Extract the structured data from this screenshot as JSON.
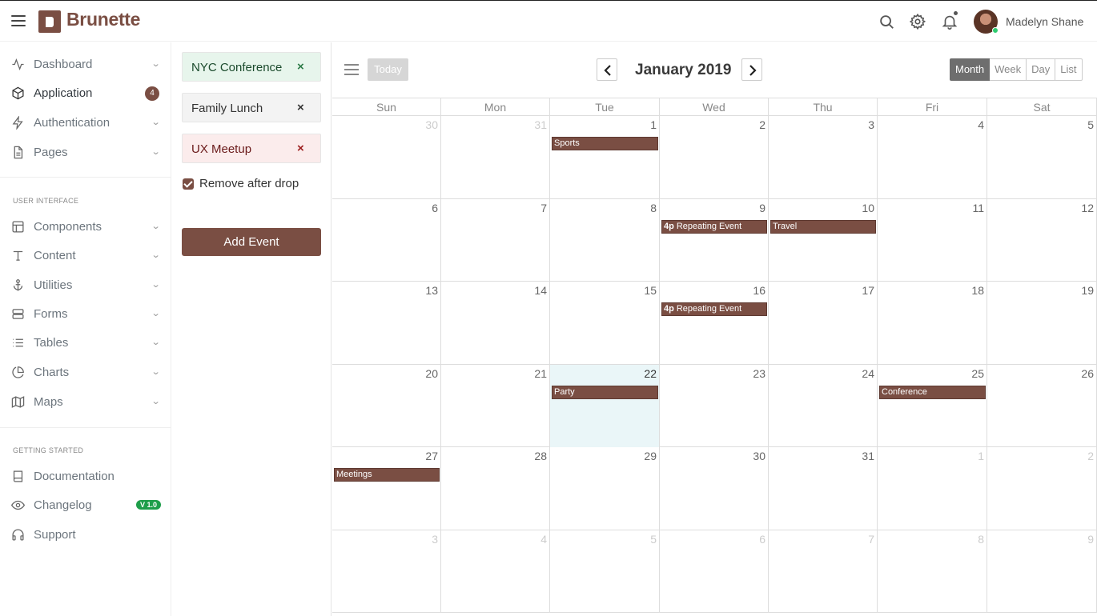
{
  "app": {
    "brand": "Brunette"
  },
  "header": {
    "user_name": "Madelyn Shane"
  },
  "sidebar": {
    "items_main": [
      {
        "label": "Dashboard",
        "icon": "activity-icon"
      },
      {
        "label": "Application",
        "icon": "cube-icon",
        "badge": "4"
      },
      {
        "label": "Authentication",
        "icon": "bolt-icon"
      },
      {
        "label": "Pages",
        "icon": "file-icon"
      }
    ],
    "section_ui": "USER INTERFACE",
    "items_ui": [
      {
        "label": "Components",
        "icon": "layout-icon"
      },
      {
        "label": "Content",
        "icon": "type-icon"
      },
      {
        "label": "Utilities",
        "icon": "anchor-icon"
      },
      {
        "label": "Forms",
        "icon": "server-icon"
      },
      {
        "label": "Tables",
        "icon": "list-icon"
      },
      {
        "label": "Charts",
        "icon": "pie-chart-icon"
      },
      {
        "label": "Maps",
        "icon": "map-icon"
      }
    ],
    "section_start": "GETTING STARTED",
    "items_start": [
      {
        "label": "Documentation",
        "icon": "book-icon"
      },
      {
        "label": "Changelog",
        "icon": "eye-icon",
        "version": "V 1.0"
      },
      {
        "label": "Support",
        "icon": "headphones-icon"
      }
    ]
  },
  "external_events": {
    "items": [
      {
        "label": "NYC Conference",
        "close": "×"
      },
      {
        "label": "Family Lunch",
        "close": "×"
      },
      {
        "label": "UX Meetup",
        "close": "×"
      }
    ],
    "remove_after_drop_label": "Remove after drop",
    "remove_after_drop_checked": true,
    "add_button": "Add Event"
  },
  "calendar": {
    "today_label": "Today",
    "title": "January 2019",
    "views": [
      "Month",
      "Week",
      "Day",
      "List"
    ],
    "active_view": "Month",
    "weekdays": [
      "Sun",
      "Mon",
      "Tue",
      "Wed",
      "Thu",
      "Fri",
      "Sat"
    ],
    "weeks": [
      [
        {
          "d": "30",
          "o": true
        },
        {
          "d": "31",
          "o": true
        },
        {
          "d": "1"
        },
        {
          "d": "2"
        },
        {
          "d": "3"
        },
        {
          "d": "4"
        },
        {
          "d": "5"
        }
      ],
      [
        {
          "d": "6"
        },
        {
          "d": "7"
        },
        {
          "d": "8"
        },
        {
          "d": "9"
        },
        {
          "d": "10"
        },
        {
          "d": "11"
        },
        {
          "d": "12"
        }
      ],
      [
        {
          "d": "13"
        },
        {
          "d": "14"
        },
        {
          "d": "15"
        },
        {
          "d": "16"
        },
        {
          "d": "17"
        },
        {
          "d": "18"
        },
        {
          "d": "19"
        }
      ],
      [
        {
          "d": "20"
        },
        {
          "d": "21"
        },
        {
          "d": "22",
          "today": true
        },
        {
          "d": "23"
        },
        {
          "d": "24"
        },
        {
          "d": "25"
        },
        {
          "d": "26"
        }
      ],
      [
        {
          "d": "27"
        },
        {
          "d": "28"
        },
        {
          "d": "29"
        },
        {
          "d": "30"
        },
        {
          "d": "31"
        },
        {
          "d": "1",
          "o": true
        },
        {
          "d": "2",
          "o": true
        }
      ],
      [
        {
          "d": "3",
          "o": true
        },
        {
          "d": "4",
          "o": true
        },
        {
          "d": "5",
          "o": true
        },
        {
          "d": "6",
          "o": true
        },
        {
          "d": "7",
          "o": true
        },
        {
          "d": "8",
          "o": true
        },
        {
          "d": "9",
          "o": true
        }
      ]
    ],
    "events": [
      {
        "week": 0,
        "day": 2,
        "time": "",
        "title": "Sports"
      },
      {
        "week": 1,
        "day": 3,
        "time": "4p",
        "title": "Repeating Event"
      },
      {
        "week": 1,
        "day": 4,
        "time": "",
        "title": "Travel"
      },
      {
        "week": 2,
        "day": 3,
        "time": "4p",
        "title": "Repeating Event"
      },
      {
        "week": 3,
        "day": 2,
        "time": "",
        "title": "Party"
      },
      {
        "week": 3,
        "day": 5,
        "time": "",
        "title": "Conference"
      },
      {
        "week": 4,
        "day": 0,
        "time": "",
        "title": "Meetings"
      }
    ]
  },
  "colors": {
    "brand": "#7a4e43",
    "today_bg": "#eaf6f8",
    "version_badge": "#1e9e4a"
  }
}
